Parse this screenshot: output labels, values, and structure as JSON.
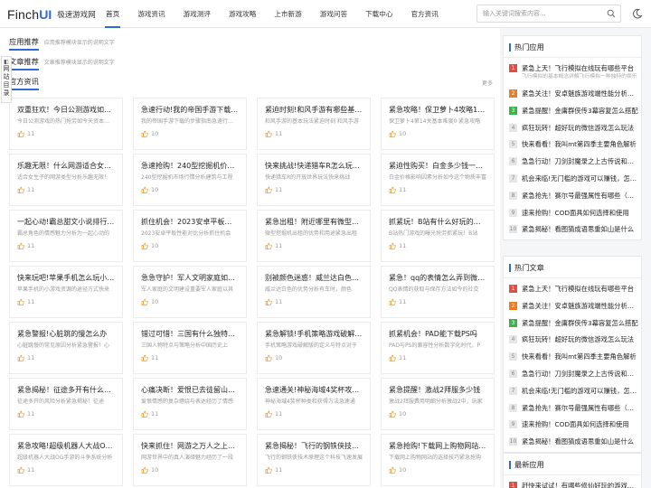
{
  "header": {
    "logo_text": "Finch",
    "logo_accent": "UI",
    "site_name": "极速游戏网",
    "nav": [
      "首页",
      "游戏资讯",
      "游戏测评",
      "游戏攻略",
      "上市新游",
      "游戏问答",
      "下载中心",
      "官方资讯"
    ],
    "search_placeholder": "输入关键词搜索内容..."
  },
  "float_tab": {
    "label": "网站目录"
  },
  "sections": [
    {
      "title": "应用推荐",
      "desc": "应用推荐模块显示的说明文字"
    },
    {
      "title": "文章推荐",
      "desc": "文章推荐模块显示的说明文字"
    },
    {
      "title": "官方资讯",
      "more": "更多"
    }
  ],
  "cards": [
    {
      "title": "双重狂欢！今日公测游戏如何玩转？",
      "desc": "今日公测游戏的热门抢劳如今天资本化活动精彩",
      "likes": "11"
    },
    {
      "title": "急速行动!我的帝国手游下载指南",
      "desc": "我的帝国手游下载的步骤指南急速行动起来",
      "likes": "10"
    },
    {
      "title": "紧迫时刻!和风手游有哪些基本玩法",
      "desc": "和风手游的基本玩法紧迫时刻 和风手游",
      "likes": "11"
    },
    {
      "title": "紧急攻略！保卫萝卜4攻略14关最新版",
      "desc": "保卫萝卜4第14关基本难度0 紧急攻略",
      "likes": "10"
    },
    {
      "title": "乐趣无限！什么网游适合女生玩",
      "desc": "适合女生子的网游类型分析乐趣无限！",
      "likes": "11"
    },
    {
      "title": "急速抢购！240型挖掘机价格多少",
      "desc": "240型挖掘机市场行情分析建筑与工程",
      "likes": "10"
    },
    {
      "title": "快来挑战!快递猎车R怎么玩成功率高",
      "desc": "快递猎车R的开放世界玩法快来挑战",
      "likes": "11"
    },
    {
      "title": "紧迫性购买！白金多少钱一g官方",
      "desc": "白金价格影响因素分析如今这个物质丰富",
      "likes": "11"
    },
    {
      "title": "一起心动!霸总甜文小说排行榜推荐",
      "desc": "霸总角色的情感魅力分析为一起心动的",
      "likes": "11"
    },
    {
      "title": "抓住机会！2023安卓平板排行榜推荐",
      "desc": "2023安卓平板性能对比分析抓住机会",
      "likes": "10"
    },
    {
      "title": "紧急出租！附近哪里有微型挖掘机出租",
      "desc": "微型挖掘机出租的优势和用途紧急出租",
      "likes": "11"
    },
    {
      "title": "抓紧玩！B站有什么好玩的游戏推荐",
      "desc": "B站热门游戏的曝光抢劳抓紧玩！B站",
      "likes": "11"
    },
    {
      "title": "快来玩吧!苹果手机怎么玩小游戏",
      "desc": "苹果手机的小游戏资源的途径方式快来",
      "likes": "11"
    },
    {
      "title": "急急守护！军人文明家庭如何评选",
      "desc": "军人家庭的文明建设重要军人家庭以其",
      "likes": "10"
    },
    {
      "title": "别被颜色迷惑！威兰达白色好看吗",
      "desc": "威兰达白色的优势分析有车时，颜色",
      "likes": "11"
    },
    {
      "title": "紧急！qq的表情怎么弄到微信上",
      "desc": "QQ表情的获取与保存方法如今的社交",
      "likes": "11"
    },
    {
      "title": "紧急警报!心脏跳的慢怎么办",
      "desc": "心脏跳慢的常见原因分析紧急警报！心",
      "likes": "11"
    },
    {
      "title": "错过可惜！三国有什么独特好玩的游戏",
      "desc": "三国人物特点与策略分析中国历史上",
      "likes": "11"
    },
    {
      "title": "紧急解锁!手机策略游戏破解版排行",
      "desc": "手机策略游戏破解版的定义与特点对于",
      "likes": "10"
    },
    {
      "title": "抓紧机会！PAD能下载PS吗",
      "desc": "PAD与PS的兼容性分析数字化时代，P",
      "likes": "11"
    },
    {
      "title": "紧急揭秘！征途多开有什么好处",
      "desc": "征途多开的风险分析紧急揭秘！征途",
      "likes": "11"
    },
    {
      "title": "心痛决断！爱恨已去徒留山长水远",
      "desc": "爱恨情感的复杂缠绕与表达经历了情感",
      "likes": "11"
    },
    {
      "title": "急速通关!神秘海域4奖杯攻略详解",
      "desc": "神秘海域4奖杯种类和获得方法急速通",
      "likes": "11"
    },
    {
      "title": "紧急提醒！激战2拜服多少钱",
      "desc": "激战2拜服费用明细分析激战2中，玩家",
      "likes": "10"
    },
    {
      "title": "紧急攻略!超级机器人大战OG手游",
      "desc": "超级机器人大战OG手游的斗争系统分析",
      "likes": "11"
    },
    {
      "title": "快来抓住！网游之万人之上小说",
      "desc": "网游世界中的真人演绎魅力经历了一段",
      "likes": "10"
    },
    {
      "title": "紧急揭秘！飞行的钢铁侠技术原理",
      "desc": "飞行的钢铁侠技术原理这个科技飞速发展",
      "likes": "11"
    },
    {
      "title": "紧急抢购!下载网上购物网站该怎么",
      "desc": "下载网上购物网站的选择技巧紧急抢购",
      "likes": "10"
    }
  ],
  "sidebar": {
    "panels": [
      {
        "title": "热门应用",
        "items": [
          {
            "num": "1",
            "text": "紧急上天！飞行模拟在线玩有哪些平台",
            "sub": "飞行模拟的基本概念详解飞行模拟一种独特的娱乐"
          },
          {
            "num": "2",
            "text": "紧急关注！安卓魅族游戏端性能分析报告"
          },
          {
            "num": "3",
            "text": "紧急提醒！金庸群侠传3幕容复怎么搭配"
          },
          {
            "num": "4",
            "text": "疯狂玩转！超好玩的微信游戏怎么玩法"
          },
          {
            "num": "5",
            "text": "快来看看！我叫mt第四季主要角色解析"
          },
          {
            "num": "6",
            "text": "急急行动！刀剑封魔录之上古传说和画面"
          },
          {
            "num": "7",
            "text": "机会来临!无门槛的游戏可以赚钱，怎么赚"
          },
          {
            "num": "8",
            "text": "紧急抢先！赛尔号最强属性有哪些（赛尔号"
          },
          {
            "num": "9",
            "text": "速来抢购！COD面具如何选择和使用"
          },
          {
            "num": "10",
            "text": "紧急揭秘！看图猜成语思重如山是什么"
          }
        ]
      },
      {
        "title": "热门文章",
        "items": [
          {
            "num": "1",
            "text": "紧急上天！飞行模拟在线玩有哪些平台"
          },
          {
            "num": "2",
            "text": "紧急关注！安卓魅族游戏端性能分析报告"
          },
          {
            "num": "3",
            "text": "紧急提醒！金庸群侠传3幕容复怎么搭配"
          },
          {
            "num": "4",
            "text": "疯狂玩转！超好玩的微信游戏怎么玩法"
          },
          {
            "num": "5",
            "text": "快来看看！我叫mt第四季主要角色解析"
          },
          {
            "num": "6",
            "text": "急急行动！刀剑封魔录之上古传说和画面"
          },
          {
            "num": "7",
            "text": "机会来临!无门槛的游戏可以赚钱，怎么赚"
          },
          {
            "num": "8",
            "text": "紧急抢先！赛尔号最强属性有哪些（赛尔号"
          },
          {
            "num": "9",
            "text": "速来抢购！COD面具如何选择和使用"
          },
          {
            "num": "10",
            "text": "紧急揭秘！看图猜成语思重如山是什么"
          }
        ]
      },
      {
        "title": "最新应用",
        "items": [
          {
            "num": "1",
            "text": "赶快来试试！有哪些修仙好玩的游戏推荐"
          }
        ]
      }
    ]
  },
  "colors": {
    "accent": "#2e6ad0",
    "rank1": "#e54d42",
    "rank2": "#f37b1d",
    "rank3": "#39b54a"
  }
}
